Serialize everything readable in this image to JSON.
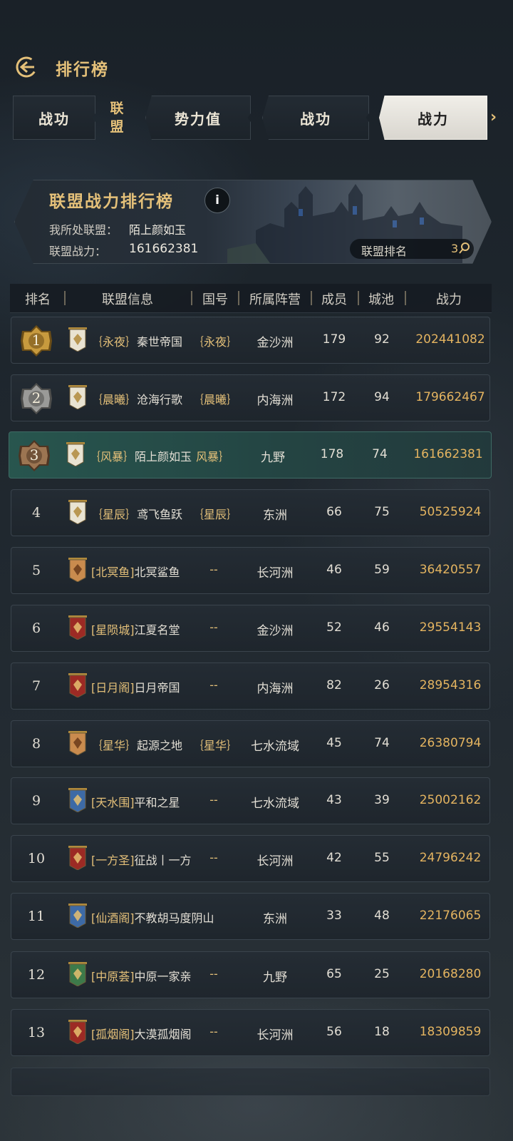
{
  "header": {
    "title": "排行榜"
  },
  "tabs": {
    "category_line1": "联",
    "category_line2": "盟",
    "items": [
      {
        "label": "战功"
      },
      {
        "label": "势力值"
      },
      {
        "label": "战功"
      },
      {
        "label": "战力"
      }
    ],
    "active_index": 3
  },
  "banner": {
    "title": "联盟战力排行榜",
    "info_icon": "i",
    "my_alliance_label": "我所处联盟：",
    "my_alliance_value": "陌上颜如玉",
    "power_label": "联盟战力：",
    "power_value": "161662381",
    "rank_label": "联盟排名",
    "rank_value": "3"
  },
  "table": {
    "headers": [
      "排名",
      "联盟信息",
      "国号",
      "所属阵营",
      "成员",
      "城池",
      "战力"
    ],
    "rows": [
      {
        "rank": "1",
        "tag": "｛永夜｝",
        "name": "秦世帝国",
        "nation": "｛永夜｝",
        "camp": "金沙洲",
        "members": "179",
        "cities": "92",
        "power": "202441082",
        "flag": "white-eagle-flag-icon",
        "medal": "gold"
      },
      {
        "rank": "2",
        "tag": "｛晨曦｝",
        "name": "沧海行歌",
        "nation": "｛晨曦｝",
        "camp": "内海洲",
        "members": "172",
        "cities": "94",
        "power": "179662467",
        "flag": "white-eagle-flag-icon",
        "medal": "silver"
      },
      {
        "rank": "3",
        "tag": "｛风暴｝",
        "name": "陌上颜如玉",
        "nation": "风暴｝",
        "camp": "九野",
        "members": "178",
        "cities": "74",
        "power": "161662381",
        "flag": "white-eagle-flag-icon",
        "medal": "bronze"
      },
      {
        "rank": "4",
        "tag": "｛星辰｝",
        "name": "鸢飞鱼跃",
        "nation": "｛星辰｝",
        "camp": "东洲",
        "members": "66",
        "cities": "75",
        "power": "50525924",
        "flag": "white-eagle-flag-icon"
      },
      {
        "rank": "5",
        "tag": "[北冥鱼]",
        "name": "北冥鲨鱼",
        "nation": "--",
        "camp": "长河洲",
        "members": "46",
        "cities": "59",
        "power": "36420557",
        "flag": "orange-swords-flag-icon"
      },
      {
        "rank": "6",
        "tag": "[星陨城]",
        "name": "江夏名堂",
        "nation": "--",
        "camp": "金沙洲",
        "members": "52",
        "cities": "46",
        "power": "29554143",
        "flag": "red-dragon-flag-icon"
      },
      {
        "rank": "7",
        "tag": "[日月阁]",
        "name": "日月帝国",
        "nation": "--",
        "camp": "内海洲",
        "members": "82",
        "cities": "26",
        "power": "28954316",
        "flag": "red-dragon-flag-icon"
      },
      {
        "rank": "8",
        "tag": "｛星华｝",
        "name": "起源之地",
        "nation": "｛星华｝",
        "camp": "七水流域",
        "members": "45",
        "cities": "74",
        "power": "26380794",
        "flag": "orange-swords-flag-icon"
      },
      {
        "rank": "9",
        "tag": "[天水围]",
        "name": "平和之星",
        "nation": "--",
        "camp": "七水流域",
        "members": "43",
        "cities": "39",
        "power": "25002162",
        "flag": "blue-bird-flag-icon"
      },
      {
        "rank": "10",
        "tag": "[一方圣]",
        "name": "征战丨一方",
        "nation": "--",
        "camp": "长河洲",
        "members": "42",
        "cities": "55",
        "power": "24796242",
        "flag": "red-dragon-flag-icon"
      },
      {
        "rank": "11",
        "tag": "[仙酒阁]",
        "name": "不教胡马度阴山",
        "nation": "",
        "camp": "东洲",
        "members": "33",
        "cities": "48",
        "power": "22176065",
        "flag": "blue-bird-flag-icon"
      },
      {
        "rank": "12",
        "tag": "[中原荟]",
        "name": "中原一家亲",
        "nation": "--",
        "camp": "九野",
        "members": "65",
        "cities": "25",
        "power": "20168280",
        "flag": "green-shield-flag-icon"
      },
      {
        "rank": "13",
        "tag": "[孤烟阁]",
        "name": "大漠孤烟阁",
        "nation": "--",
        "camp": "长河洲",
        "members": "56",
        "cities": "18",
        "power": "18309859",
        "flag": "red-dragon-flag-icon"
      }
    ]
  },
  "colors": {
    "accent_gold": "#e4c079",
    "power_gold": "#e4b460",
    "my_row": "#2c5a54"
  }
}
